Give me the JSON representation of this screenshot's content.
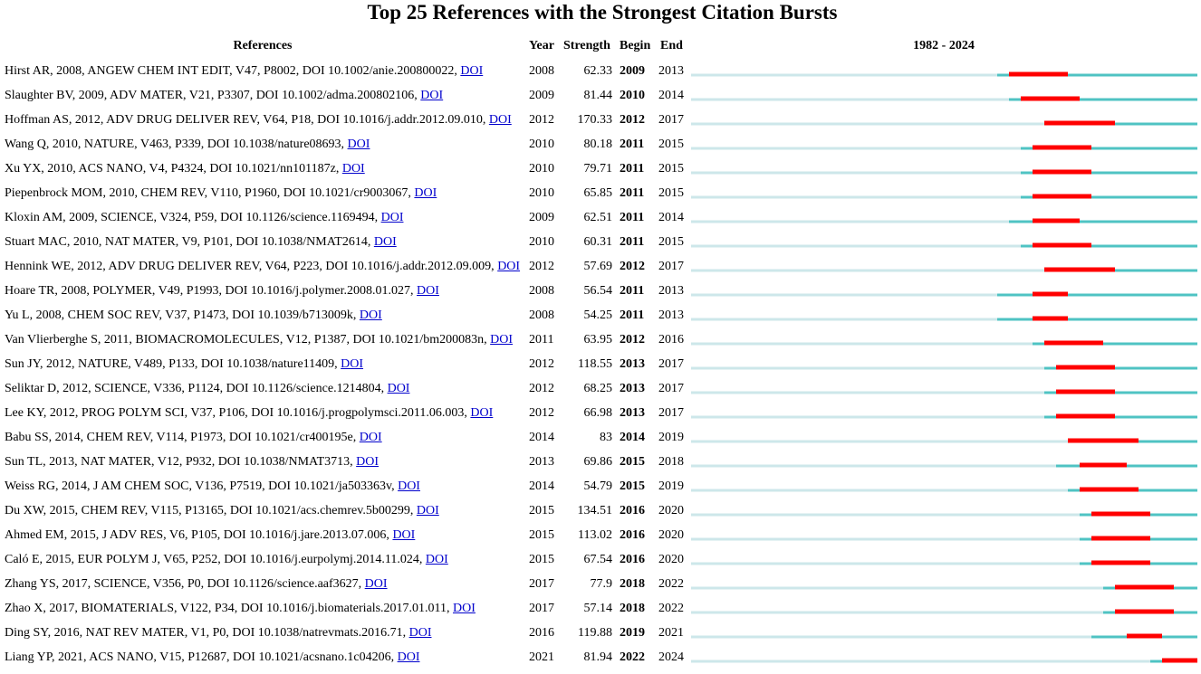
{
  "chart_data": {
    "type": "table",
    "title": "Top 25 References with the Strongest Citation Bursts",
    "columns": [
      "References",
      "Year",
      "Strength",
      "Begin",
      "End",
      "1982 - 2024"
    ],
    "timeline_range": [
      1982,
      2024
    ],
    "colors": {
      "burst": "#ff0000",
      "active": "#4fc3c3",
      "inactive": "#cde7ea",
      "link": "#0000cc"
    },
    "rows": [
      {
        "reference": "Hirst AR, 2008, ANGEW CHEM INT EDIT, V47, P8002, DOI 10.1002/anie.200800022,",
        "doi": "DOI",
        "year": 2008,
        "strength": "62.33",
        "begin": 2009,
        "end": 2013
      },
      {
        "reference": "Slaughter BV, 2009, ADV MATER, V21, P3307, DOI 10.1002/adma.200802106,",
        "doi": "DOI",
        "year": 2009,
        "strength": "81.44",
        "begin": 2010,
        "end": 2014
      },
      {
        "reference": "Hoffman AS, 2012, ADV DRUG DELIVER REV, V64, P18, DOI 10.1016/j.addr.2012.09.010,",
        "doi": "DOI",
        "year": 2012,
        "strength": "170.33",
        "begin": 2012,
        "end": 2017
      },
      {
        "reference": "Wang Q, 2010, NATURE, V463, P339, DOI 10.1038/nature08693,",
        "doi": "DOI",
        "year": 2010,
        "strength": "80.18",
        "begin": 2011,
        "end": 2015
      },
      {
        "reference": "Xu YX, 2010, ACS NANO, V4, P4324, DOI 10.1021/nn101187z,",
        "doi": "DOI",
        "year": 2010,
        "strength": "79.71",
        "begin": 2011,
        "end": 2015
      },
      {
        "reference": "Piepenbrock MOM, 2010, CHEM REV, V110, P1960, DOI 10.1021/cr9003067,",
        "doi": "DOI",
        "year": 2010,
        "strength": "65.85",
        "begin": 2011,
        "end": 2015
      },
      {
        "reference": "Kloxin AM, 2009, SCIENCE, V324, P59, DOI 10.1126/science.1169494,",
        "doi": "DOI",
        "year": 2009,
        "strength": "62.51",
        "begin": 2011,
        "end": 2014
      },
      {
        "reference": "Stuart MAC, 2010, NAT MATER, V9, P101, DOI 10.1038/NMAT2614,",
        "doi": "DOI",
        "year": 2010,
        "strength": "60.31",
        "begin": 2011,
        "end": 2015
      },
      {
        "reference": "Hennink WE, 2012, ADV DRUG DELIVER REV, V64, P223, DOI 10.1016/j.addr.2012.09.009,",
        "doi": "DOI",
        "year": 2012,
        "strength": "57.69",
        "begin": 2012,
        "end": 2017
      },
      {
        "reference": "Hoare TR, 2008, POLYMER, V49, P1993, DOI 10.1016/j.polymer.2008.01.027,",
        "doi": "DOI",
        "year": 2008,
        "strength": "56.54",
        "begin": 2011,
        "end": 2013
      },
      {
        "reference": "Yu L, 2008, CHEM SOC REV, V37, P1473, DOI 10.1039/b713009k,",
        "doi": "DOI",
        "year": 2008,
        "strength": "54.25",
        "begin": 2011,
        "end": 2013
      },
      {
        "reference": "Van Vlierberghe S, 2011, BIOMACROMOLECULES, V12, P1387, DOI 10.1021/bm200083n,",
        "doi": "DOI",
        "year": 2011,
        "strength": "63.95",
        "begin": 2012,
        "end": 2016
      },
      {
        "reference": "Sun JY, 2012, NATURE, V489, P133, DOI 10.1038/nature11409,",
        "doi": "DOI",
        "year": 2012,
        "strength": "118.55",
        "begin": 2013,
        "end": 2017
      },
      {
        "reference": "Seliktar D, 2012, SCIENCE, V336, P1124, DOI 10.1126/science.1214804,",
        "doi": "DOI",
        "year": 2012,
        "strength": "68.25",
        "begin": 2013,
        "end": 2017
      },
      {
        "reference": "Lee KY, 2012, PROG POLYM SCI, V37, P106, DOI 10.1016/j.progpolymsci.2011.06.003,",
        "doi": "DOI",
        "year": 2012,
        "strength": "66.98",
        "begin": 2013,
        "end": 2017
      },
      {
        "reference": "Babu SS, 2014, CHEM REV, V114, P1973, DOI 10.1021/cr400195e,",
        "doi": "DOI",
        "year": 2014,
        "strength": "83",
        "begin": 2014,
        "end": 2019
      },
      {
        "reference": "Sun TL, 2013, NAT MATER, V12, P932, DOI 10.1038/NMAT3713,",
        "doi": "DOI",
        "year": 2013,
        "strength": "69.86",
        "begin": 2015,
        "end": 2018
      },
      {
        "reference": "Weiss RG, 2014, J AM CHEM SOC, V136, P7519, DOI 10.1021/ja503363v,",
        "doi": "DOI",
        "year": 2014,
        "strength": "54.79",
        "begin": 2015,
        "end": 2019
      },
      {
        "reference": "Du XW, 2015, CHEM REV, V115, P13165, DOI 10.1021/acs.chemrev.5b00299,",
        "doi": "DOI",
        "year": 2015,
        "strength": "134.51",
        "begin": 2016,
        "end": 2020
      },
      {
        "reference": "Ahmed EM, 2015, J ADV RES, V6, P105, DOI 10.1016/j.jare.2013.07.006,",
        "doi": "DOI",
        "year": 2015,
        "strength": "113.02",
        "begin": 2016,
        "end": 2020
      },
      {
        "reference": "Caló E, 2015, EUR POLYM J, V65, P252, DOI 10.1016/j.eurpolymj.2014.11.024,",
        "doi": "DOI",
        "year": 2015,
        "strength": "67.54",
        "begin": 2016,
        "end": 2020
      },
      {
        "reference": "Zhang YS, 2017, SCIENCE, V356, P0, DOI 10.1126/science.aaf3627,",
        "doi": "DOI",
        "year": 2017,
        "strength": "77.9",
        "begin": 2018,
        "end": 2022
      },
      {
        "reference": "Zhao X, 2017, BIOMATERIALS, V122, P34, DOI 10.1016/j.biomaterials.2017.01.011,",
        "doi": "DOI",
        "year": 2017,
        "strength": "57.14",
        "begin": 2018,
        "end": 2022
      },
      {
        "reference": "Ding SY, 2016, NAT REV MATER, V1, P0, DOI 10.1038/natrevmats.2016.71,",
        "doi": "DOI",
        "year": 2016,
        "strength": "119.88",
        "begin": 2019,
        "end": 2021
      },
      {
        "reference": "Liang YP, 2021, ACS NANO, V15, P12687, DOI 10.1021/acsnano.1c04206,",
        "doi": "DOI",
        "year": 2021,
        "strength": "81.94",
        "begin": 2022,
        "end": 2024
      }
    ]
  }
}
